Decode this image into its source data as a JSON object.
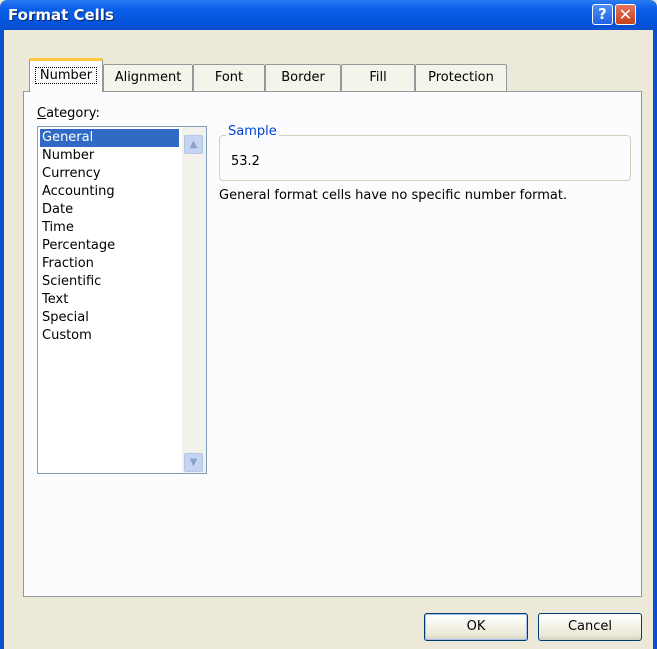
{
  "window": {
    "title": "Format Cells"
  },
  "titlebar": {
    "help_glyph": "?",
    "close_glyph": "✕"
  },
  "tabs": [
    {
      "label": "Number",
      "active": true
    },
    {
      "label": "Alignment",
      "active": false
    },
    {
      "label": "Font",
      "active": false
    },
    {
      "label": "Border",
      "active": false
    },
    {
      "label": "Fill",
      "active": false
    },
    {
      "label": "Protection",
      "active": false
    }
  ],
  "category": {
    "label_prefix": "C",
    "label_rest": "ategory:",
    "items": [
      "General",
      "Number",
      "Currency",
      "Accounting",
      "Date",
      "Time",
      "Percentage",
      "Fraction",
      "Scientific",
      "Text",
      "Special",
      "Custom"
    ],
    "selected": "General"
  },
  "sample": {
    "title": "Sample",
    "value": "53.2"
  },
  "description": "General format cells have no specific number format.",
  "buttons": {
    "ok": "OK",
    "cancel": "Cancel"
  },
  "icons": {
    "scroll_up": "▲",
    "scroll_down": "▼"
  },
  "colors": {
    "titlebar": "#0554dd",
    "selection": "#316ac5",
    "active_tab_accent": "#ffc83c",
    "group_title": "#0046d5"
  }
}
